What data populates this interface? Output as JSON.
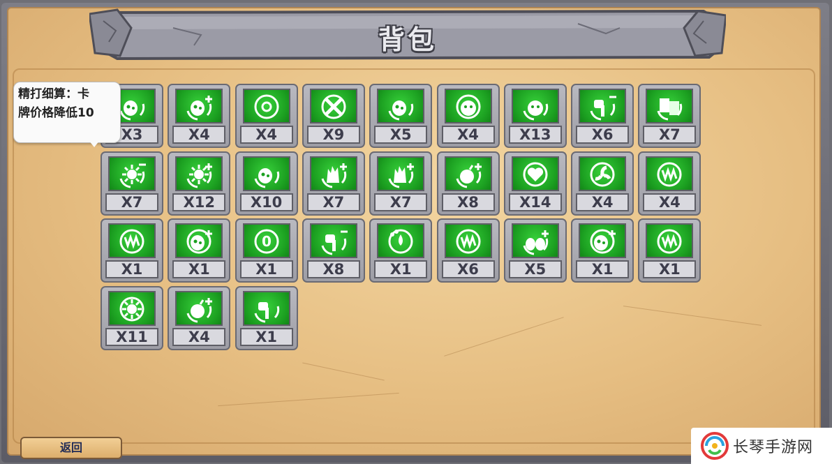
{
  "header": {
    "title": "背包"
  },
  "tooltip": {
    "line1": "精打细算：卡",
    "line2": "牌价格降低10"
  },
  "back_button": {
    "label": "返回"
  },
  "watermark": {
    "text": "长琴手游网"
  },
  "colors": {
    "card_green": "#1ca021",
    "card_frame": "#9d9da5",
    "parchment": "#e6be82",
    "count_text": "#3d3d4c"
  },
  "cards": [
    {
      "icon": "potion-swirl-icon",
      "count": "X3"
    },
    {
      "icon": "blob-plus-icon",
      "count": "X4"
    },
    {
      "icon": "crosshair-target-icon",
      "count": "X4"
    },
    {
      "icon": "crossed-target-icon",
      "count": "X9"
    },
    {
      "icon": "dice-swirl-icon",
      "count": "X5"
    },
    {
      "icon": "face-ring-icon",
      "count": "X4"
    },
    {
      "icon": "face-heart-icon",
      "count": "X13"
    },
    {
      "icon": "hand-minus-icon",
      "count": "X6"
    },
    {
      "icon": "cards-swap-icon",
      "count": "X7"
    },
    {
      "icon": "sun-minus-icon",
      "count": "X7"
    },
    {
      "icon": "sun-plus-icon",
      "count": "X12"
    },
    {
      "icon": "blob-sparkle-icon",
      "count": "X10"
    },
    {
      "icon": "spiky-plus-icon",
      "count": "X7"
    },
    {
      "icon": "spiky-plus-icon",
      "count": "X7"
    },
    {
      "icon": "bomb-plus-icon",
      "count": "X8"
    },
    {
      "icon": "heart-ring-icon",
      "count": "X14"
    },
    {
      "icon": "fan-ring-icon",
      "count": "X4"
    },
    {
      "icon": "jaw-ring-icon",
      "count": "X4"
    },
    {
      "icon": "jaw-ring-icon",
      "count": "X1"
    },
    {
      "icon": "plus-ring-icon",
      "count": "X1"
    },
    {
      "icon": "zero-ring-icon",
      "count": "X1"
    },
    {
      "icon": "hammer-minus-icon",
      "count": "X8"
    },
    {
      "icon": "drop-ring-icon",
      "count": "X1"
    },
    {
      "icon": "fang-ring-icon",
      "count": "X6"
    },
    {
      "icon": "blobs-plus-icon",
      "count": "X5"
    },
    {
      "icon": "plus-ring-icon",
      "count": "X1"
    },
    {
      "icon": "jaw-ring-icon",
      "count": "X1"
    },
    {
      "icon": "sun-ring-icon",
      "count": "X11"
    },
    {
      "icon": "bomb-plus-icon",
      "count": "X4"
    },
    {
      "icon": "tools-icon",
      "count": "X1"
    }
  ]
}
